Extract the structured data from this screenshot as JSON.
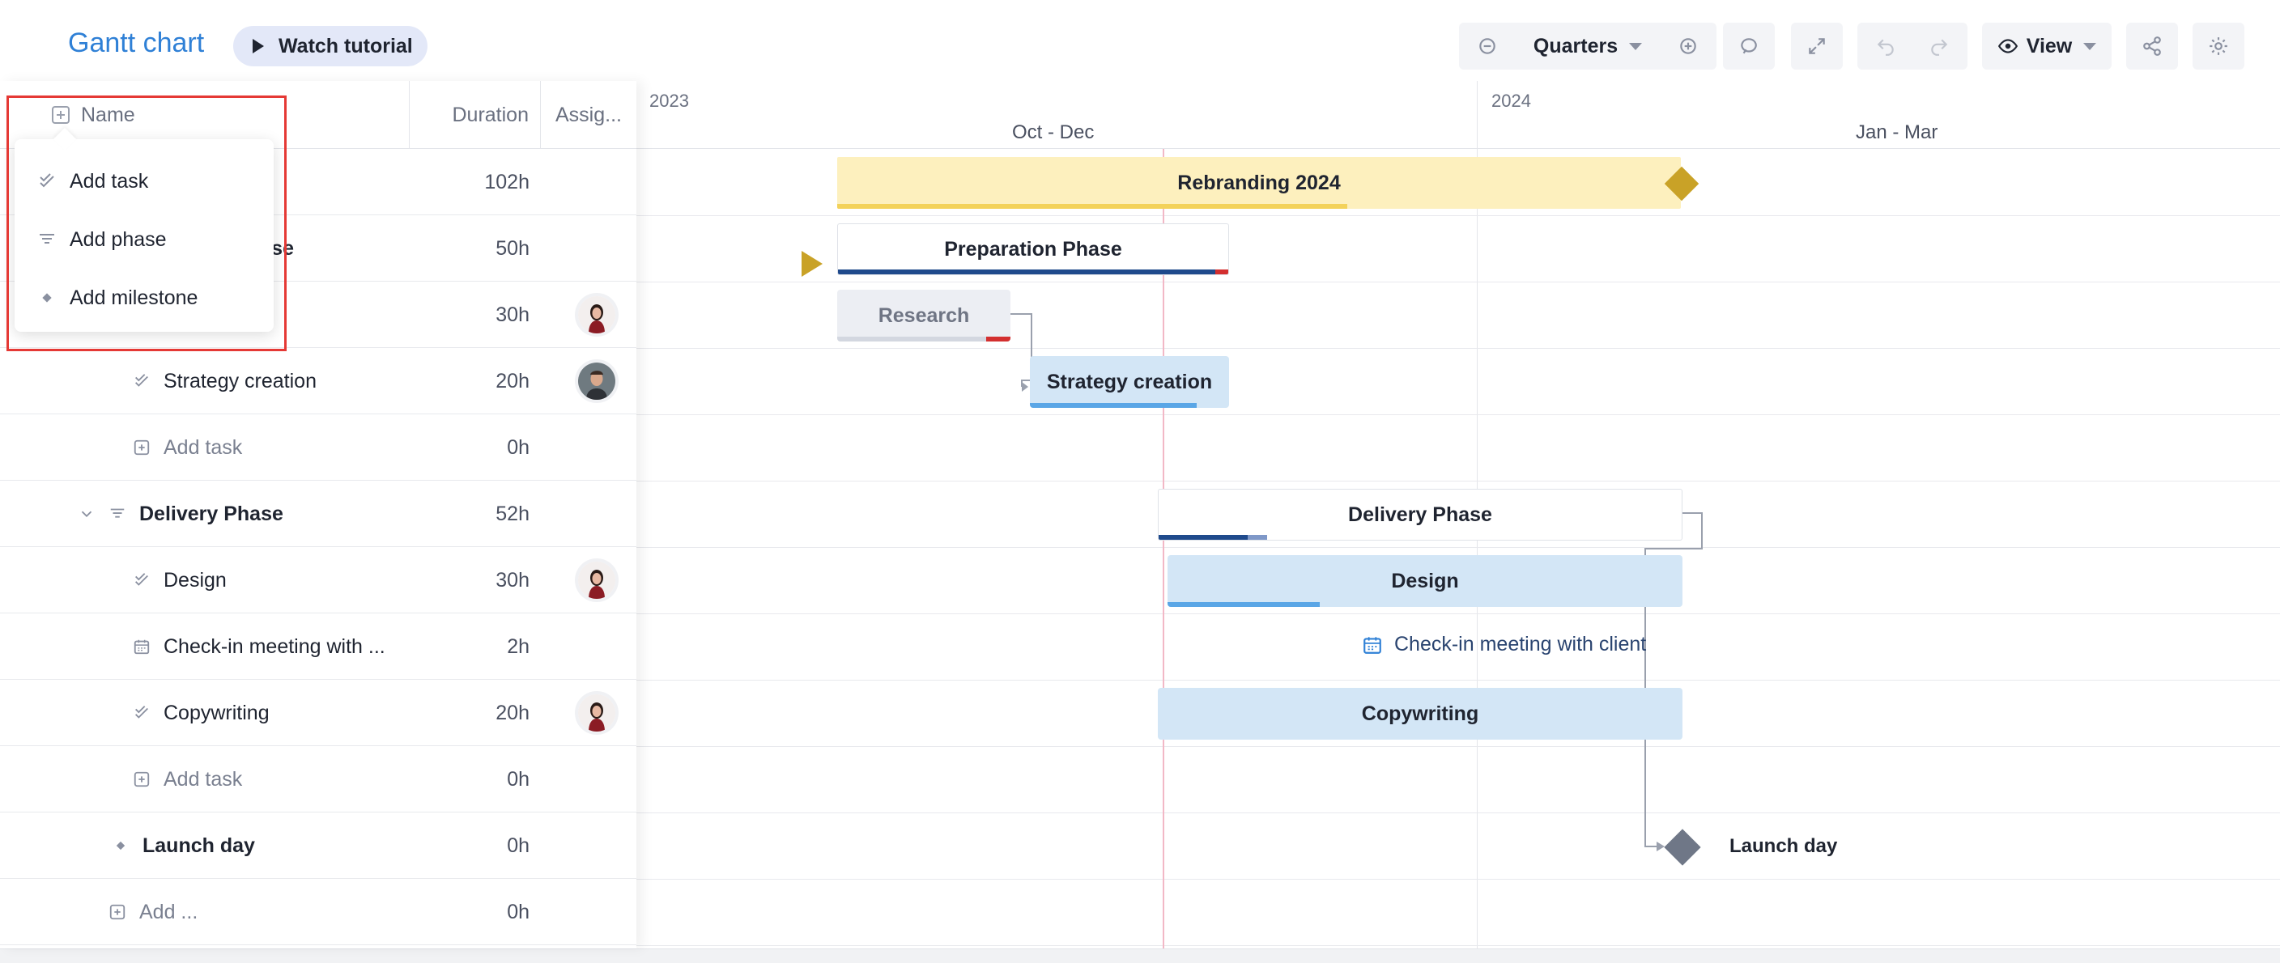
{
  "app": {
    "title": "Gantt chart",
    "tutorial_label": "Watch tutorial"
  },
  "toolbar": {
    "zoom_level": "Quarters",
    "view_label": "View"
  },
  "columns": {
    "name": "Name",
    "duration": "Duration",
    "assignee": "Assig..."
  },
  "menu": {
    "add_task": "Add task",
    "add_phase": "Add phase",
    "add_milestone": "Add milestone"
  },
  "rows": [
    {
      "name": "",
      "duration": "102h"
    },
    {
      "name": "nase",
      "duration": "50h"
    },
    {
      "name": "",
      "duration": "30h"
    },
    {
      "name": "Strategy creation",
      "duration": "20h"
    },
    {
      "name": "Add task",
      "duration": "0h"
    },
    {
      "name": "Delivery Phase",
      "duration": "52h"
    },
    {
      "name": "Design",
      "duration": "30h"
    },
    {
      "name": "Check-in meeting with ...",
      "duration": "2h"
    },
    {
      "name": "Copywriting",
      "duration": "20h"
    },
    {
      "name": "Add task",
      "duration": "0h"
    },
    {
      "name": "Launch day",
      "duration": "0h"
    },
    {
      "name": "Add ...",
      "duration": "0h"
    }
  ],
  "timeline": {
    "years": [
      "2023",
      "2024"
    ],
    "quarters": [
      "Oct - Dec",
      "Jan - Mar"
    ]
  },
  "bars": {
    "project": "Rebranding 2024",
    "prep_phase": "Preparation Phase",
    "research": "Research",
    "strategy": "Strategy creation",
    "delivery_phase": "Delivery Phase",
    "design": "Design",
    "checkin": "Check-in meeting with client",
    "copywriting": "Copywriting",
    "launch": "Launch day"
  },
  "colors": {
    "accent": "#2f80d6",
    "project_bar": "#fdf0be",
    "project_progress": "#f3d25a",
    "phase_progress": "#1f4a8c",
    "task_bar": "#d3e6f6",
    "task_progress": "#5aa6e6",
    "late": "#d32f2f",
    "milestone": "#c9a227",
    "launch_milestone": "#6f7787",
    "highlight": "#e53935"
  }
}
